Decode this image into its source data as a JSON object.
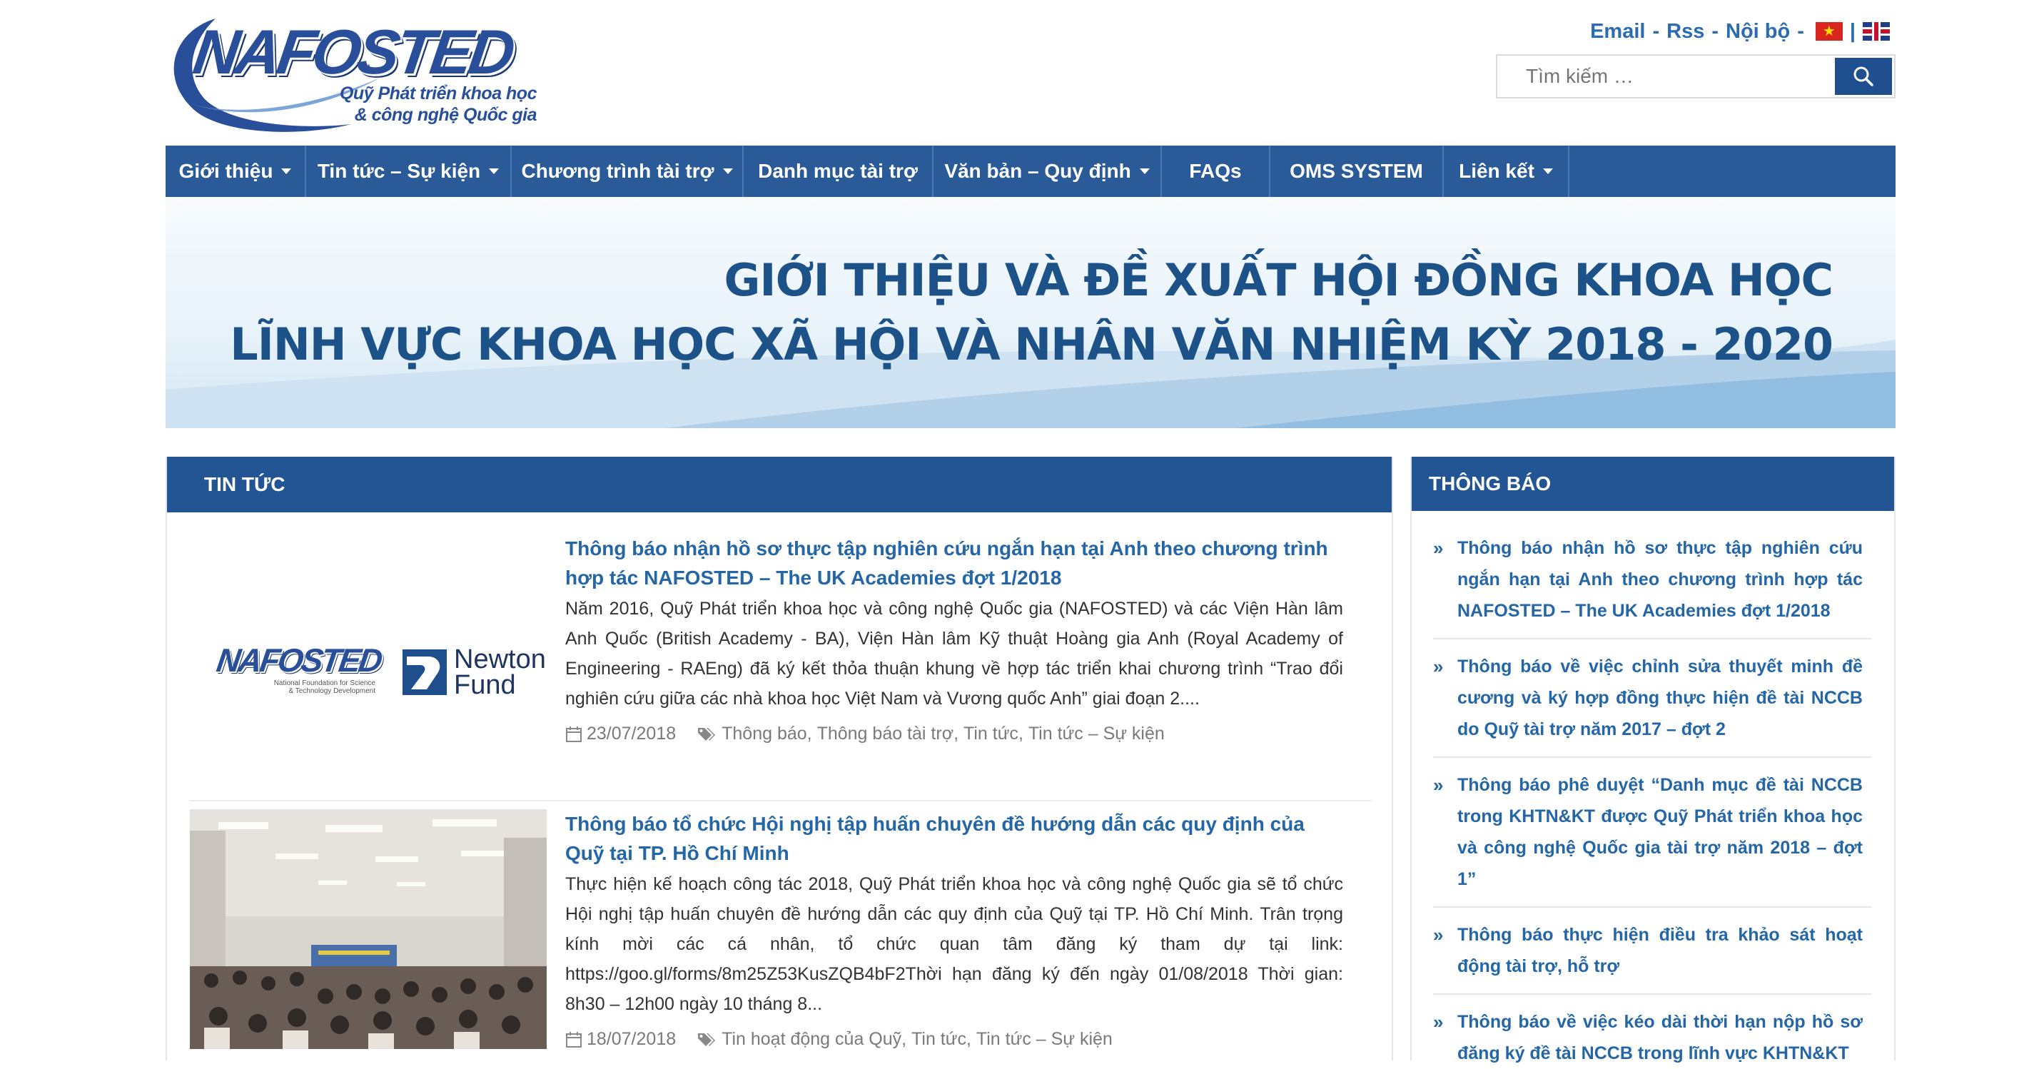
{
  "logo": {
    "wordmark": "NAFOSTED",
    "tagline_1": "Quỹ Phát triển khoa học",
    "tagline_2": "& công nghệ Quốc gia"
  },
  "toplinks": {
    "email": "Email",
    "rss": "Rss",
    "internal": "Nội bộ",
    "sep": "-",
    "lang_sep": "|"
  },
  "search": {
    "placeholder": "Tìm kiếm …",
    "button_icon": "search-icon"
  },
  "nav": {
    "items": [
      {
        "label": "Giới thiệu",
        "dropdown": true
      },
      {
        "label": "Tin tức – Sự kiện",
        "dropdown": true
      },
      {
        "label": "Chương trình tài trợ",
        "dropdown": true
      },
      {
        "label": "Danh mục tài trợ",
        "dropdown": false
      },
      {
        "label": "Văn bản – Quy định",
        "dropdown": true
      },
      {
        "label": "FAQs",
        "dropdown": false
      },
      {
        "label": "OMS SYSTEM",
        "dropdown": false
      },
      {
        "label": "Liên kết",
        "dropdown": true
      }
    ]
  },
  "banner": {
    "line_1": "GIỚI THIỆU VÀ ĐỀ XUẤT HỘI ĐỒNG KHOA HỌC",
    "line_2": "LĨNH VỰC KHOA HỌC XÃ HỘI VÀ NHÂN VĂN NHIỆM KỲ 2018 - 2020"
  },
  "news": {
    "heading": "TIN TỨC",
    "items": [
      {
        "title": "Thông báo nhận hồ sơ thực tập nghiên cứu ngắn hạn tại Anh theo chương trình hợp tác NAFOSTED – The UK Academies đợt 1/2018",
        "excerpt": "Năm 2016, Quỹ Phát triển khoa học và công nghệ Quốc gia (NAFOSTED) và các Viện Hàn lâm Anh Quốc (British Academy - BA), Viện Hàn lâm Kỹ thuật Hoàng gia Anh (Royal Academy of Engineering - RAEng) đã ký kết thỏa thuận khung về hợp tác triển khai chương trình “Trao đổi nghiên cứu giữa các nhà khoa học Việt Nam và Vương quốc Anh” giai đoạn 2....",
        "date": "23/07/2018",
        "categories": [
          "Thông báo",
          "Thông báo tài trợ",
          "Tin tức",
          "Tin tức – Sự kiện"
        ],
        "thumb": {
          "nafosted": "NAFOSTED",
          "nafosted_sub": "National Foundation for Science & Technology Development",
          "newton_1": "Newton",
          "newton_2": "Fund"
        }
      },
      {
        "title": "Thông báo tổ chức Hội nghị tập huấn chuyên đề hướng dẫn các quy định của Quỹ tại TP. Hồ Chí Minh",
        "excerpt": "Thực hiện kế hoạch công tác 2018, Quỹ Phát triển khoa học và công nghệ Quốc gia sẽ tổ chức Hội nghị tập huấn chuyên đề hướng dẫn các quy định của Quỹ tại TP. Hồ Chí Minh. Trân trọng kính mời các cá nhân, tổ chức quan tâm đăng ký tham dự tại link: https://goo.gl/forms/8m25Z53KusZQB4bF2Thời hạn đăng ký đến ngày 01/08/2018 Thời gian: 8h30 – 12h00 ngày 10 tháng 8...",
        "date": "18/07/2018",
        "categories": [
          "Tin hoạt động của Quỹ",
          "Tin tức",
          "Tin tức – Sự kiện"
        ]
      }
    ],
    "category_separator": ", "
  },
  "notices": {
    "heading": "THÔNG BÁO",
    "bullet": "»",
    "items": [
      "Thông báo nhận hồ sơ thực tập nghiên cứu ngắn hạn tại Anh theo chương trình hợp tác NAFOSTED – The UK Academies đợt 1/2018",
      "Thông báo về việc chỉnh sửa thuyết minh đề cương và ký hợp đồng thực hiện đề tài NCCB do Quỹ tài trợ năm 2017 – đợt 2",
      "Thông báo phê duyệt “Danh mục đề tài NCCB trong KHTN&KT được Quỹ Phát triển khoa học và công nghệ Quốc gia tài trợ năm 2018 – đợt 1”",
      "Thông báo thực hiện điều tra khảo sát hoạt động tài trợ, hỗ trợ",
      "Thông báo về việc kéo dài thời hạn nộp hồ sơ đăng ký đề tài NCCB trong lĩnh vực KHTN&KT"
    ]
  },
  "colors": {
    "nav_bg": "#2a5b98",
    "panel_head": "#235594",
    "link": "#2566a6",
    "banner_text": "#1d5288"
  }
}
